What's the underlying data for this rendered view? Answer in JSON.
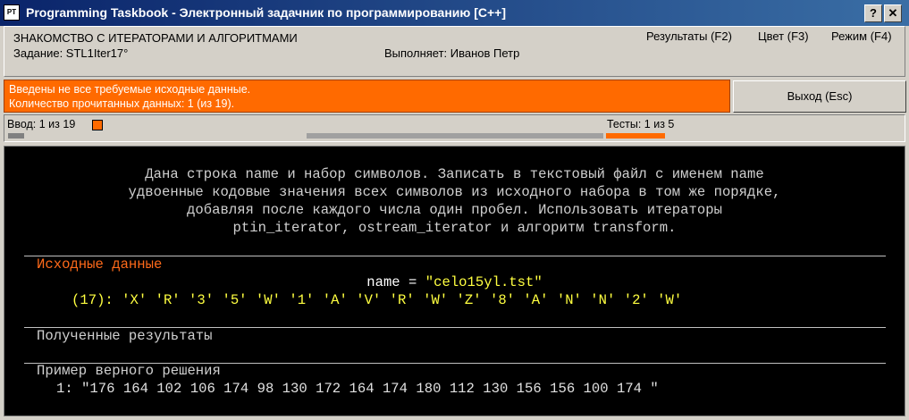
{
  "window": {
    "icon_text": "PT",
    "title": "Programming Taskbook - Электронный задачник по программированию [C++]",
    "help_label": "?",
    "close_label": "✕"
  },
  "info": {
    "topic": "ЗНАКОМСТВО С ИТЕРАТОРАМИ И АЛГОРИТМАМИ",
    "task": "Задание: STL1Iter17°",
    "executor": "Выполняет: Иванов Петр",
    "menu": {
      "results": "Результаты (F2)",
      "color": "Цвет (F3)",
      "mode": "Режим (F4)"
    }
  },
  "status": {
    "line1": "Введены не все требуемые исходные данные.",
    "line2": "Количество прочитанных данных: 1 (из 19).",
    "color": "#ff6a00"
  },
  "exit_button": "Выход (Esc)",
  "progress": {
    "input_label": "Ввод:  1 из 19",
    "input_fraction": 0.0526,
    "tests_label": "Тесты:  1 из 5",
    "tests_fraction": 0.2
  },
  "console": {
    "description": "Дана строка name и набор символов. Записать в текстовый файл с именем name\nудвоенные кодовые значения всех символов из исходного набора в том же порядке,\nдобавляя после каждого числа один пробел. Использовать итераторы\nptin_iterator, ostream_iterator и алгоритм transform.",
    "section_input": "Исходные данные",
    "name_prefix": "name = ",
    "name_value": "\"celo15yl.tst\"",
    "chars_count": "(17):",
    "chars": [
      "'X'",
      "'R'",
      "'3'",
      "'5'",
      "'W'",
      "'1'",
      "'A'",
      "'V'",
      "'R'",
      "'W'",
      "'Z'",
      "'8'",
      "'A'",
      "'N'",
      "'N'",
      "'2'",
      "'W'"
    ],
    "section_output": "Полученные результаты",
    "section_sample": "Пример верного решения",
    "sample_line": "1: \"176 164 102 106 174 98 130 172 164 174 180 112 130 156 156 100 174 \""
  }
}
